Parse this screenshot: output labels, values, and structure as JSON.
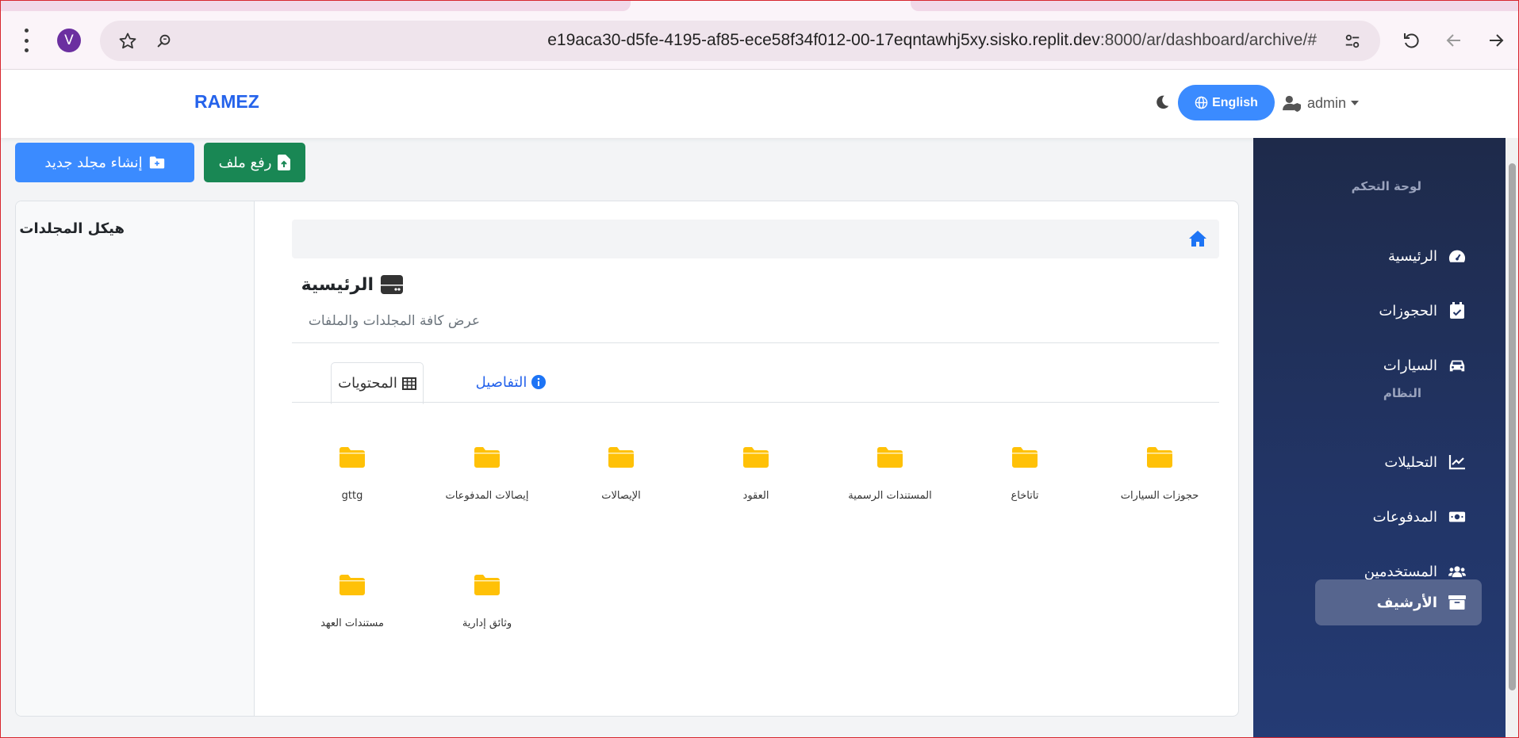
{
  "browser": {
    "avatar_letter": "V",
    "url_main": "e19aca30-d5fe-4195-af85-ece58f34f012-00-17eqntawhj5xy.sisko.replit.dev",
    "url_rest": ":8000/ar/dashboard/archive/#",
    "icons": [
      "more-vert-icon",
      "star-icon",
      "search-lens-icon",
      "tune-icon",
      "reload-icon",
      "back-arrow-icon",
      "forward-arrow-icon"
    ]
  },
  "header": {
    "brand": "RAMEZ",
    "language_button": "English",
    "user": "admin"
  },
  "actions": {
    "new_folder": "إنشاء مجلد جديد",
    "upload_file": "رفع ملف"
  },
  "tree": {
    "title": "هيكل المجلدات"
  },
  "main": {
    "title": "الرئيسية",
    "subtitle": "عرض كافة المجلدات والملفات",
    "tabs": {
      "contents": "المحتويات",
      "details": "التفاصيل"
    },
    "folders": [
      "حجوزات السيارات",
      "تاتاخاع",
      "المستندات الرسمية",
      "العقود",
      "الإيصالات",
      "إيصالات المدفوعات",
      "gttg",
      "وثائق إدارية",
      "مستندات العهد"
    ]
  },
  "sidebar": {
    "section_dashboard": "لوحة التحكم",
    "section_system": "النظام",
    "items": [
      {
        "label": "الرئيسية",
        "icon": "dashboard-gauge-icon"
      },
      {
        "label": "الحجوزات",
        "icon": "calendar-check-icon"
      },
      {
        "label": "السيارات",
        "icon": "car-icon"
      },
      {
        "label": "التحليلات",
        "icon": "chart-line-icon"
      },
      {
        "label": "المدفوعات",
        "icon": "money-bill-icon"
      },
      {
        "label": "المستخدمين",
        "icon": "users-icon"
      },
      {
        "label": "الأرشيف",
        "icon": "archive-box-icon"
      }
    ],
    "active_item": "الأرشيف"
  },
  "colors": {
    "primary": "#3b8bff",
    "success": "#198754",
    "folder": "#ffc107",
    "sidebar_bg": "#1e2a4a",
    "brand": "#2563eb"
  }
}
